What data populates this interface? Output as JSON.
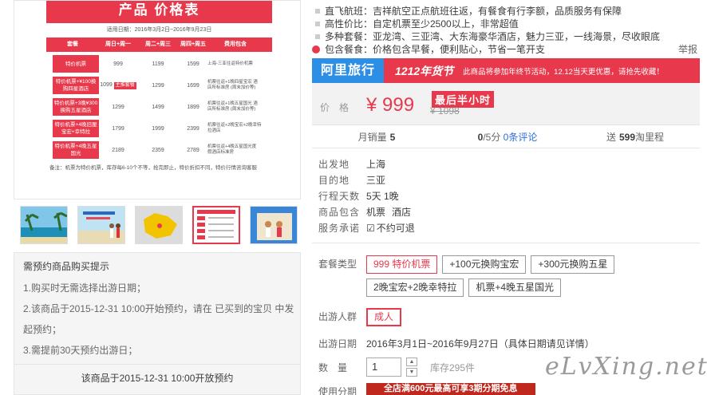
{
  "price_table": {
    "title": "产品 价格表",
    "dates": "适用日期：2016年3月2日~2016年9月23日",
    "headers": [
      "套餐",
      "周日+周一",
      "周二+周三",
      "周四+周五",
      "费用包含"
    ],
    "rows": [
      {
        "pkg": "特价机票",
        "p1": "999",
        "p2": "1199",
        "p3": "1599",
        "inc": "上海-三亚往返特价机票"
      },
      {
        "pkg": "特价机票+¥100换购四星酒店",
        "p1": "1099",
        "p1_badge": "主推套餐",
        "p2": "1299",
        "p3": "1699",
        "inc": "机票往返+1晚四星宝宏 酒店所标准房 (周末加价等)"
      },
      {
        "pkg": "特价机票+3晚¥300换购五星酒店",
        "p1": "1299",
        "p2": "1499",
        "p3": "1899",
        "inc": "机票往返+1晚五星国光 酒店所标准房 (周末加价等)"
      },
      {
        "pkg": "特价机票+4晚旧厘宝宏+幸特拉",
        "p1": "1799",
        "p2": "1999",
        "p3": "2399",
        "inc": "机票往返+2晚宝宏+2晚幸特拉酒店"
      },
      {
        "pkg": "特价机票+4晚五星国光",
        "p1": "2189",
        "p2": "2359",
        "p3": "2789",
        "inc": "机票往返+4晚五星国光度 假酒店标准房"
      }
    ],
    "note": "备注：机票为特价机票，库存每6-10个不等，抢完即止，特价折扣不同，特价行情咨询客服"
  },
  "thumbnails": [
    "beach-photo",
    "couple-beach-photo",
    "map-photo",
    "price-table-photo",
    "family-photo"
  ],
  "notice": {
    "title": "需预约商品购买提示",
    "lines": [
      "1.购买时无需选择出游日期；",
      "2.该商品于2015-12-31 10:00开始预约，请在 已买到的宝贝 中发起预约；",
      "3.需提前30天预约出游日；"
    ],
    "footer": "该商品于2015-12-31 10:00开放预约"
  },
  "features": [
    "直飞航班：吉祥航空正点航班往返，有餐食有行李额，品质服务有保障",
    "高性价比：自定机票至少2500以上，非常超值",
    "多种套餐：亚龙湾、三亚湾、大东海豪华酒店，魅力三亚，一线海景，尽收眼底",
    "包含餐食：价格包含早餐，便利贴心，节省一笔开支"
  ],
  "report": "举报",
  "banner": {
    "brand": "阿里旅行",
    "sale": "1212年货节",
    "promo": "此商品将参加年终节活动，12.12当天更优惠，请抢先收藏！"
  },
  "price": {
    "label": "价格",
    "current": "¥ 999",
    "tag": "最后半小时",
    "original": "¥ 1098"
  },
  "stats": {
    "monthly_label": "月销量",
    "monthly_value": "5",
    "rating": "0",
    "rating_suffix": "/5分",
    "reviews": "0条评论",
    "points_prefix": "送",
    "points_value": "599",
    "points_suffix": "淘里程"
  },
  "info": [
    {
      "k": "出发地",
      "v": [
        "上海"
      ]
    },
    {
      "k": "目的地",
      "v": [
        "三亚"
      ]
    },
    {
      "k": "行程天数",
      "v": [
        "5天 1晚"
      ]
    },
    {
      "k": "商品包含",
      "v": [
        "机票",
        "酒店"
      ]
    },
    {
      "k": "服务承诺",
      "v": [
        "不约可退"
      ]
    }
  ],
  "package": {
    "label": "套餐类型",
    "options": [
      "999 特价机票",
      "+100元换购宝宏",
      "+300元换购五星",
      "2晚宝宏+2晚幸特拉",
      "机票+4晚五星国光"
    ],
    "selected_index": 0
  },
  "crowd": {
    "label": "出游人群",
    "option": "成人"
  },
  "dates": {
    "label": "出游日期",
    "value": "2016年3月1日~2016年9月27日（具体日期请见详情）"
  },
  "quantity": {
    "label": "数量",
    "value": "1",
    "stock": "库存295件"
  },
  "installment": {
    "label": "使用分期",
    "badge": "全店满600元最高可享3期分期免息"
  },
  "watermark": "eLvXing.net",
  "colors": {
    "accent": "#e8394c",
    "brand_blue": "#2d8ee6"
  }
}
